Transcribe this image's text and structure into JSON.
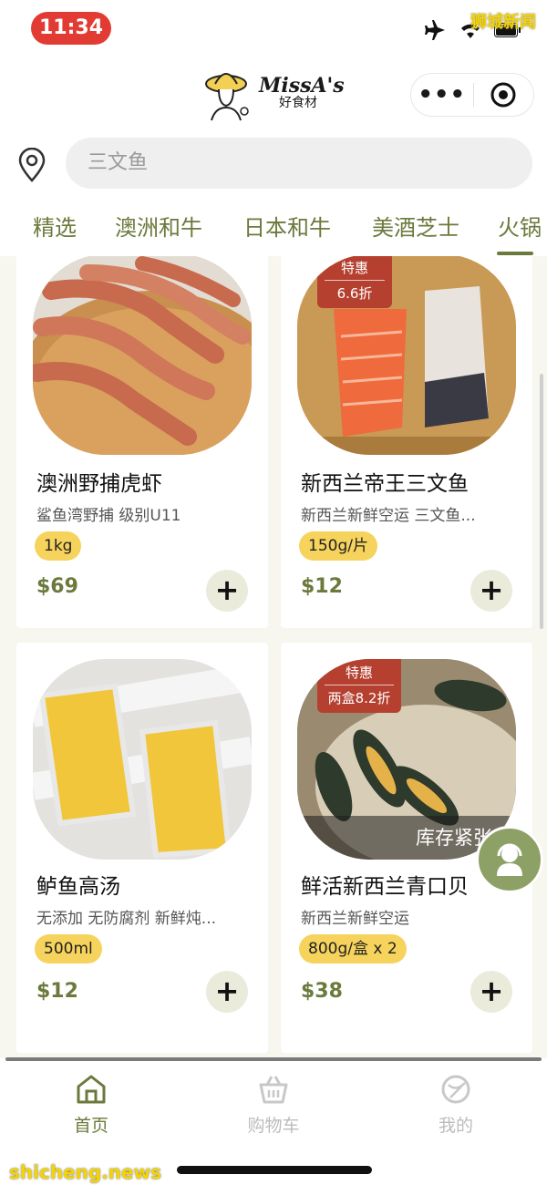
{
  "status": {
    "time": "11:34",
    "watermark": "狮城新闻"
  },
  "header": {
    "logo_script": "MissA's",
    "logo_sub": "好食材",
    "more": "•••"
  },
  "search": {
    "placeholder": "三文鱼"
  },
  "tabs": [
    {
      "label": "精选"
    },
    {
      "label": "澳洲和牛"
    },
    {
      "label": "日本和牛"
    },
    {
      "label": "美酒芝士"
    },
    {
      "label": "火锅"
    }
  ],
  "products": [
    {
      "name": "澳洲野捕虎虾",
      "desc": "鲨鱼湾野捕 级别U11",
      "spec": "1kg",
      "price": "$69"
    },
    {
      "name": "新西兰帝王三文鱼",
      "desc": "新西兰新鲜空运 三文鱼...",
      "spec": "150g/片",
      "price": "$12",
      "badge_top": "特惠",
      "badge_bottom": "6.6折"
    },
    {
      "name": "鲈鱼高汤",
      "desc": "无添加 无防腐剂 新鲜炖...",
      "spec": "500ml",
      "price": "$12"
    },
    {
      "name": "鲜活新西兰青口贝",
      "desc": "新西兰新鲜空运",
      "spec": "800g/盒 x 2",
      "price": "$38",
      "badge_top": "特惠",
      "badge_bottom": "两盒8.2折",
      "stock_note": "库存紧张"
    }
  ],
  "bottom_nav": [
    {
      "label": "首页",
      "active": true
    },
    {
      "label": "购物车",
      "active": false
    },
    {
      "label": "我的",
      "active": false
    }
  ],
  "footer_watermark": "shicheng.news",
  "colors": {
    "accent": "#6b7a3c",
    "spec_bg": "#f6d35c",
    "badge": "#b5402f",
    "time_pill": "#e23b33"
  }
}
